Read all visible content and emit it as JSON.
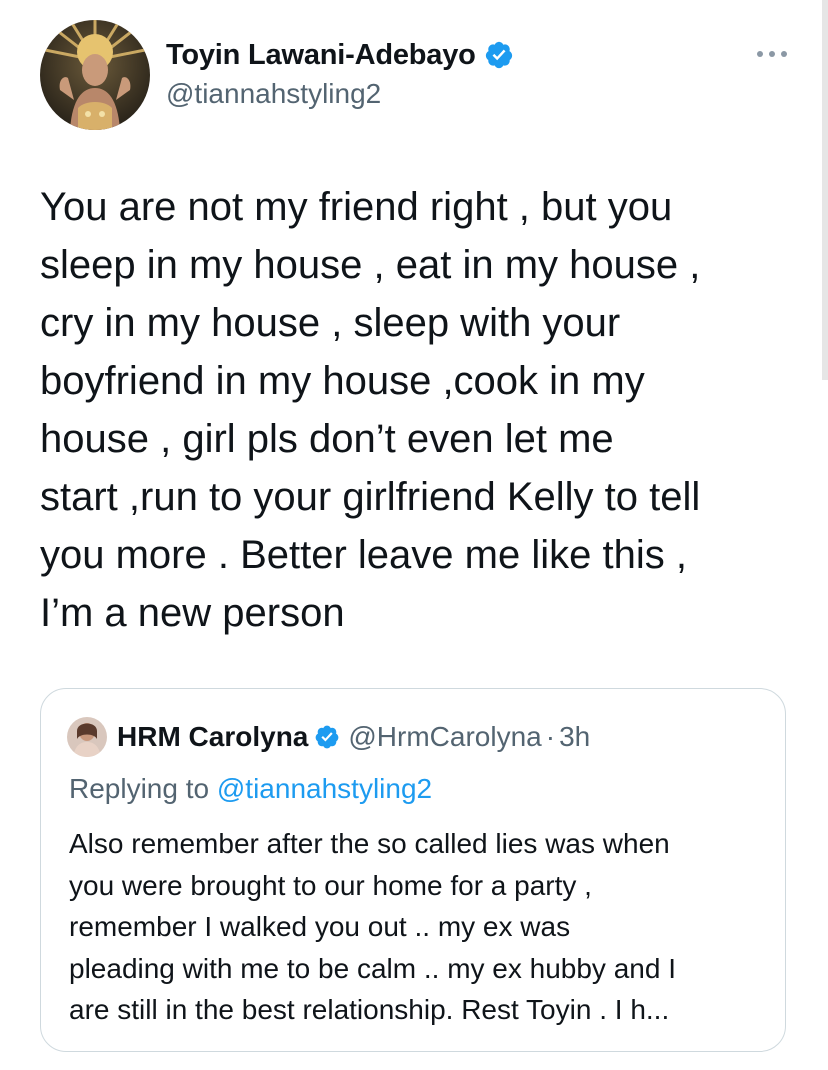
{
  "author": {
    "display_name": "Toyin Lawani-Adebayo",
    "handle": "@tiannahstyling2",
    "avatar_icon": "profile-photo-avatar",
    "verified_icon": "verified-badge-icon",
    "more_icon": "more-options-icon"
  },
  "tweet": {
    "lines": [
      "You are not my friend right , but you",
      "sleep in my house , eat in my house ,",
      "cry in my house , sleep with your",
      "boyfriend in my house ,cook in my",
      "house , girl pls don’t even let me",
      "start ,run to your girlfriend Kelly to tell",
      "you more . Better leave me like this  ,",
      "I’m a new person"
    ]
  },
  "quoted_tweet": {
    "display_name": "HRM Carolyna",
    "handle": "@HrmCarolyna",
    "separator": "·",
    "time": "3h",
    "replying_prefix": "Replying to ",
    "replying_to": "@tiannahstyling2",
    "lines": [
      "Also remember after the so called lies was when",
      "you were brought to our home for a party ,",
      "remember I walked you out .. my ex was",
      "pleading with me to be calm .. my ex hubby and I",
      "are still in the best relationship. Rest Toyin . I h..."
    ]
  },
  "colors": {
    "text": "#0f1419",
    "secondary": "#536471",
    "accent": "#1d9bf0",
    "border": "#cfd9de"
  }
}
